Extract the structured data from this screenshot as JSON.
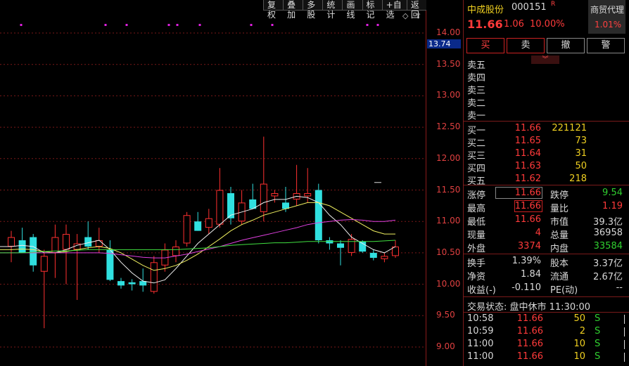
{
  "toolbar": {
    "items": [
      "复权",
      "叠加",
      "多股",
      "统计",
      "画线",
      "标记",
      "+自选",
      "返回"
    ]
  },
  "chart": {
    "y_labels": [
      "14.00",
      "13.50",
      "13.00",
      "12.50",
      "12.00",
      "11.50",
      "11.00",
      "10.50",
      "10.00",
      "9.50",
      "9.00"
    ],
    "y_values": [
      14.0,
      13.5,
      13.0,
      12.5,
      12.0,
      11.5,
      11.0,
      10.5,
      10.0,
      9.5,
      9.0
    ],
    "current_price_tag": "13.74",
    "up_color": "#ff3030",
    "down_color": "#30e0e0",
    "candles": [
      {
        "o": 10.6,
        "h": 10.85,
        "l": 10.35,
        "c": 10.75
      },
      {
        "o": 10.7,
        "h": 10.9,
        "l": 10.55,
        "c": 10.5
      },
      {
        "o": 10.75,
        "h": 10.8,
        "l": 10.2,
        "c": 10.3
      },
      {
        "o": 10.2,
        "h": 10.55,
        "l": 9.3,
        "c": 10.45
      },
      {
        "o": 10.5,
        "h": 10.95,
        "l": 10.1,
        "c": 10.75
      },
      {
        "o": 10.55,
        "h": 10.95,
        "l": 10.0,
        "c": 10.8
      },
      {
        "o": 10.55,
        "h": 10.8,
        "l": 9.75,
        "c": 10.65
      },
      {
        "o": 10.75,
        "h": 11.0,
        "l": 10.55,
        "c": 10.6
      },
      {
        "o": 10.6,
        "h": 10.9,
        "l": 10.5,
        "c": 10.7
      },
      {
        "o": 10.55,
        "h": 10.7,
        "l": 10.05,
        "c": 10.07
      },
      {
        "o": 10.05,
        "h": 10.1,
        "l": 9.93,
        "c": 9.98
      },
      {
        "o": 10.03,
        "h": 10.08,
        "l": 9.9,
        "c": 10.0
      },
      {
        "o": 10.05,
        "h": 10.25,
        "l": 9.88,
        "c": 9.98
      },
      {
        "o": 9.88,
        "h": 10.45,
        "l": 9.85,
        "c": 10.35
      },
      {
        "o": 10.3,
        "h": 10.65,
        "l": 10.2,
        "c": 10.55
      },
      {
        "o": 10.45,
        "h": 10.7,
        "l": 10.35,
        "c": 10.6
      },
      {
        "o": 10.65,
        "h": 11.15,
        "l": 10.6,
        "c": 11.1
      },
      {
        "o": 11.0,
        "h": 11.15,
        "l": 10.85,
        "c": 10.85
      },
      {
        "o": 10.9,
        "h": 11.2,
        "l": 10.8,
        "c": 11.05
      },
      {
        "o": 10.95,
        "h": 11.85,
        "l": 10.9,
        "c": 11.5
      },
      {
        "o": 11.45,
        "h": 11.55,
        "l": 10.95,
        "c": 11.05
      },
      {
        "o": 11.0,
        "h": 11.5,
        "l": 10.95,
        "c": 11.3
      },
      {
        "o": 11.35,
        "h": 11.6,
        "l": 11.2,
        "c": 11.2
      },
      {
        "o": 11.15,
        "h": 12.35,
        "l": 11.0,
        "c": 11.6
      },
      {
        "o": 11.4,
        "h": 11.5,
        "l": 11.3,
        "c": 11.45
      },
      {
        "o": 11.3,
        "h": 11.55,
        "l": 11.15,
        "c": 11.2
      },
      {
        "o": 11.35,
        "h": 11.9,
        "l": 11.25,
        "c": 11.45
      },
      {
        "o": 11.4,
        "h": 11.85,
        "l": 11.3,
        "c": 11.45
      },
      {
        "o": 11.5,
        "h": 11.6,
        "l": 10.65,
        "c": 10.7
      },
      {
        "o": 10.7,
        "h": 10.75,
        "l": 10.55,
        "c": 10.65
      },
      {
        "o": 10.65,
        "h": 10.7,
        "l": 10.3,
        "c": 10.58
      },
      {
        "o": 10.5,
        "h": 10.8,
        "l": 10.45,
        "c": 10.72
      },
      {
        "o": 10.68,
        "h": 10.7,
        "l": 10.5,
        "c": 10.52
      },
      {
        "o": 10.5,
        "h": 10.55,
        "l": 10.38,
        "c": 10.42
      },
      {
        "o": 10.4,
        "h": 10.5,
        "l": 10.35,
        "c": 10.45
      },
      {
        "o": 10.45,
        "h": 10.7,
        "l": 10.42,
        "c": 10.6
      }
    ],
    "ma_lines": [
      {
        "color": "#f0f0f0",
        "values": [
          10.6,
          10.62,
          10.6,
          10.5,
          10.5,
          10.55,
          10.62,
          10.66,
          10.7,
          10.55,
          10.35,
          10.18,
          10.05,
          10.02,
          10.07,
          10.25,
          10.45,
          10.65,
          10.8,
          10.95,
          11.1,
          11.15,
          11.2,
          11.3,
          11.35,
          11.35,
          11.4,
          11.38,
          11.3,
          11.1,
          10.95,
          10.75,
          10.65,
          10.55,
          10.5,
          10.6
        ]
      },
      {
        "color": "#f0f060",
        "values": [
          10.55,
          10.56,
          10.55,
          10.52,
          10.5,
          10.52,
          10.55,
          10.58,
          10.6,
          10.57,
          10.5,
          10.4,
          10.3,
          10.22,
          10.25,
          10.3,
          10.38,
          10.48,
          10.6,
          10.72,
          10.85,
          10.95,
          11.02,
          11.1,
          11.15,
          11.2,
          11.25,
          11.3,
          11.3,
          11.25,
          11.15,
          11.05,
          10.95,
          10.85,
          10.8,
          10.8
        ]
      },
      {
        "color": "#e040e0",
        "values": [
          10.5,
          10.5,
          10.5,
          10.5,
          10.5,
          10.5,
          10.5,
          10.5,
          10.5,
          10.49,
          10.47,
          10.45,
          10.43,
          10.42,
          10.42,
          10.45,
          10.48,
          10.52,
          10.56,
          10.6,
          10.65,
          10.7,
          10.74,
          10.78,
          10.82,
          10.86,
          10.9,
          10.95,
          10.98,
          11.0,
          11.02,
          11.03,
          11.02,
          11.0,
          11.0,
          11.02
        ]
      },
      {
        "color": "#40e040",
        "values": [
          10.5,
          10.5,
          10.51,
          10.52,
          10.53,
          10.53,
          10.54,
          10.55,
          10.55,
          10.55,
          10.55,
          10.55,
          10.55,
          10.55,
          10.55,
          10.55,
          10.56,
          10.57,
          10.58,
          10.6,
          10.62,
          10.63,
          10.64,
          10.65,
          10.66,
          10.66,
          10.67,
          10.68,
          10.68,
          10.68,
          10.68,
          10.68,
          10.68,
          10.68,
          10.69,
          10.7
        ]
      }
    ]
  },
  "stock": {
    "name": "中成股份",
    "code": "000151",
    "flag": "R",
    "price": "11.66",
    "change": "1.06",
    "pct": "10.00%"
  },
  "sector": {
    "name": "商贸代理",
    "pct": "1.01%"
  },
  "actions": [
    "买",
    "卖",
    "撤",
    "警"
  ],
  "sell_levels": [
    "卖五",
    "卖四",
    "卖三",
    "卖二",
    "卖一"
  ],
  "buy_levels": [
    {
      "label": "买一",
      "price": "11.66",
      "vol": "221121"
    },
    {
      "label": "买二",
      "price": "11.65",
      "vol": "73"
    },
    {
      "label": "买三",
      "price": "11.64",
      "vol": "31"
    },
    {
      "label": "买四",
      "price": "11.63",
      "vol": "50"
    },
    {
      "label": "买五",
      "price": "11.62",
      "vol": "218"
    }
  ],
  "stats": {
    "limit_up_label": "涨停",
    "limit_up": "11.66",
    "limit_down_label": "跌停",
    "limit_down": "9.54",
    "high_label": "最高",
    "high": "11.66",
    "vol_ratio_label": "量比",
    "vol_ratio": "1.19",
    "low_label": "最低",
    "low": "11.66",
    "mktcap_label": "市值",
    "mktcap": "39.3亿",
    "cur_vol_label": "现量",
    "cur_vol": "4",
    "total_vol_label": "总量",
    "total_vol": "36958",
    "outer_label": "外盘",
    "outer": "3374",
    "inner_label": "内盘",
    "inner": "33584",
    "turnover_label": "换手",
    "turnover": "1.39%",
    "shares_label": "股本",
    "shares": "3.37亿",
    "nav_label": "净资",
    "nav": "1.84",
    "float_label": "流通",
    "float": "2.67亿",
    "eps_label": "收益(-)",
    "eps": "-0.110",
    "pe_label": "PE(动)",
    "pe": "--"
  },
  "trade_status": "交易状态: 盘中休市 11:30:00",
  "ticks": [
    {
      "time": "10:58",
      "price": "11.66",
      "vol": "50",
      "side": "S"
    },
    {
      "time": "10:59",
      "price": "11.66",
      "vol": "2",
      "side": "S"
    },
    {
      "time": "11:00",
      "price": "11.66",
      "vol": "10",
      "side": "S"
    },
    {
      "time": "11:00",
      "price": "11.66",
      "vol": "10",
      "side": "S"
    }
  ]
}
